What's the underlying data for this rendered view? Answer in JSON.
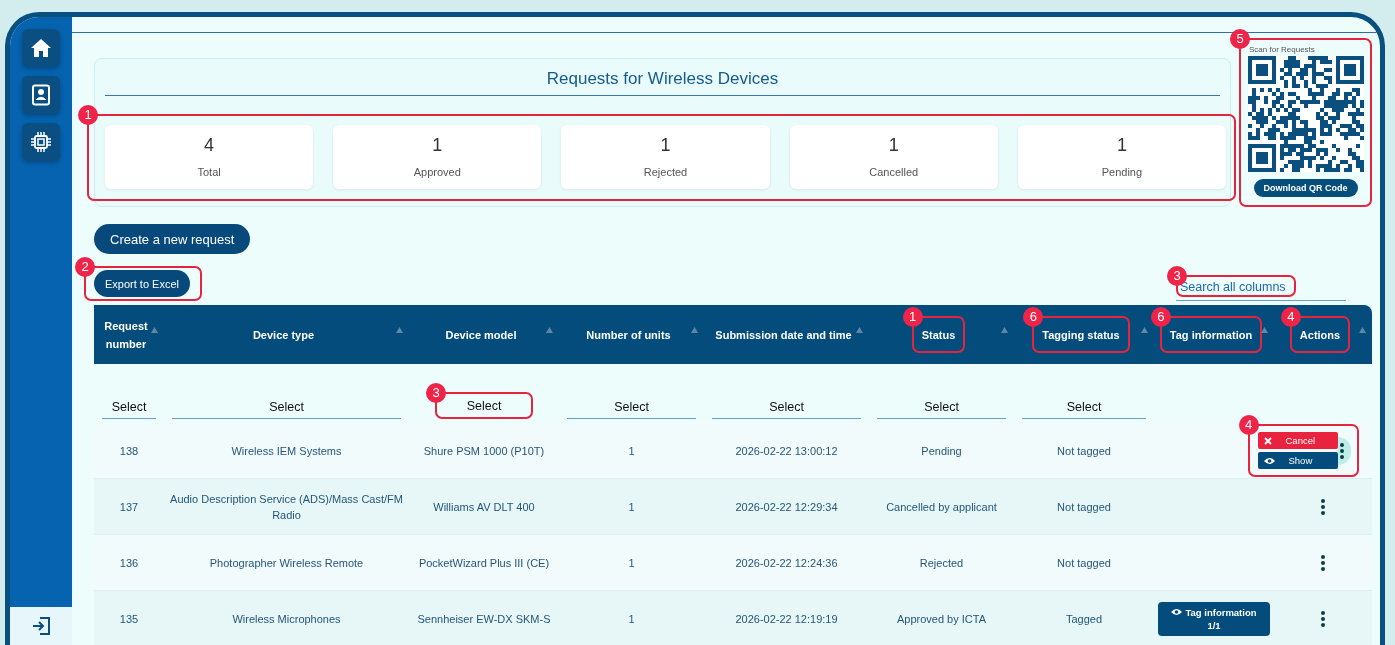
{
  "sidebar": {
    "items": [
      {
        "kind": "home"
      },
      {
        "kind": "profile"
      },
      {
        "kind": "chip"
      }
    ],
    "footer": {
      "kind": "logout"
    }
  },
  "summary": {
    "title": "Requests for Wireless Devices",
    "callout": "1",
    "stats": [
      {
        "value": "4",
        "label": "Total"
      },
      {
        "value": "1",
        "label": "Approved"
      },
      {
        "value": "1",
        "label": "Rejected"
      },
      {
        "value": "1",
        "label": "Cancelled"
      },
      {
        "value": "1",
        "label": "Pending"
      }
    ]
  },
  "qr_panel": {
    "caption": "Scan for Requests",
    "button": "Download QR Code",
    "callout": "5"
  },
  "create_button": "Create a new request",
  "export_button": {
    "label": "Export to Excel",
    "callout": "2"
  },
  "search": {
    "placeholder": "Search all columns",
    "callout": "3"
  },
  "table": {
    "columns": [
      {
        "label": "Request number"
      },
      {
        "label": "Device type"
      },
      {
        "label": "Device model"
      },
      {
        "label": "Number of units"
      },
      {
        "label": "Submission date and time"
      },
      {
        "label": "Status",
        "callout": "1"
      },
      {
        "label": "Tagging status",
        "callout": "6"
      },
      {
        "label": "Tag information",
        "callout": "6"
      },
      {
        "label": "Actions",
        "callout": "4"
      }
    ],
    "filters": [
      {
        "value": "Select"
      },
      {
        "value": "Select"
      },
      {
        "value": "Select",
        "callout": "3"
      },
      {
        "value": "Select"
      },
      {
        "value": "Select"
      },
      {
        "value": "Select"
      },
      {
        "value": "Select"
      }
    ],
    "rows": [
      {
        "cells": [
          "138",
          "Wireless IEM Systems",
          "Shure PSM 1000 (P10T)",
          "1",
          "2026-02-22 13:00:12",
          "Pending",
          "Not tagged"
        ],
        "menu_open": true,
        "menu_callout": "4",
        "menu": [
          {
            "kind": "cancel",
            "label": "Cancel"
          },
          {
            "kind": "show",
            "label": "Show"
          }
        ]
      },
      {
        "cells": [
          "137",
          "Audio Description Service (ADS)/Mass Cast/FM Radio",
          "Williams AV DLT 400",
          "1",
          "2026-02-22 12:29:34",
          "Cancelled by applicant",
          "Not tagged"
        ],
        "menu_open": false
      },
      {
        "cells": [
          "136",
          "Photographer Wireless Remote",
          "PocketWizard Plus III (CE)",
          "1",
          "2026-02-22 12:24:36",
          "Rejected",
          "Not tagged"
        ],
        "menu_open": false
      },
      {
        "cells": [
          "135",
          "Wireless Microphones",
          "Sennheiser EW-DX SKM-S",
          "1",
          "2026-02-22 12:19:19",
          "Approved by ICTA",
          "Tagged"
        ],
        "menu_open": false,
        "tag_button": {
          "label": "Tag information",
          "count": "1/1"
        }
      }
    ]
  }
}
